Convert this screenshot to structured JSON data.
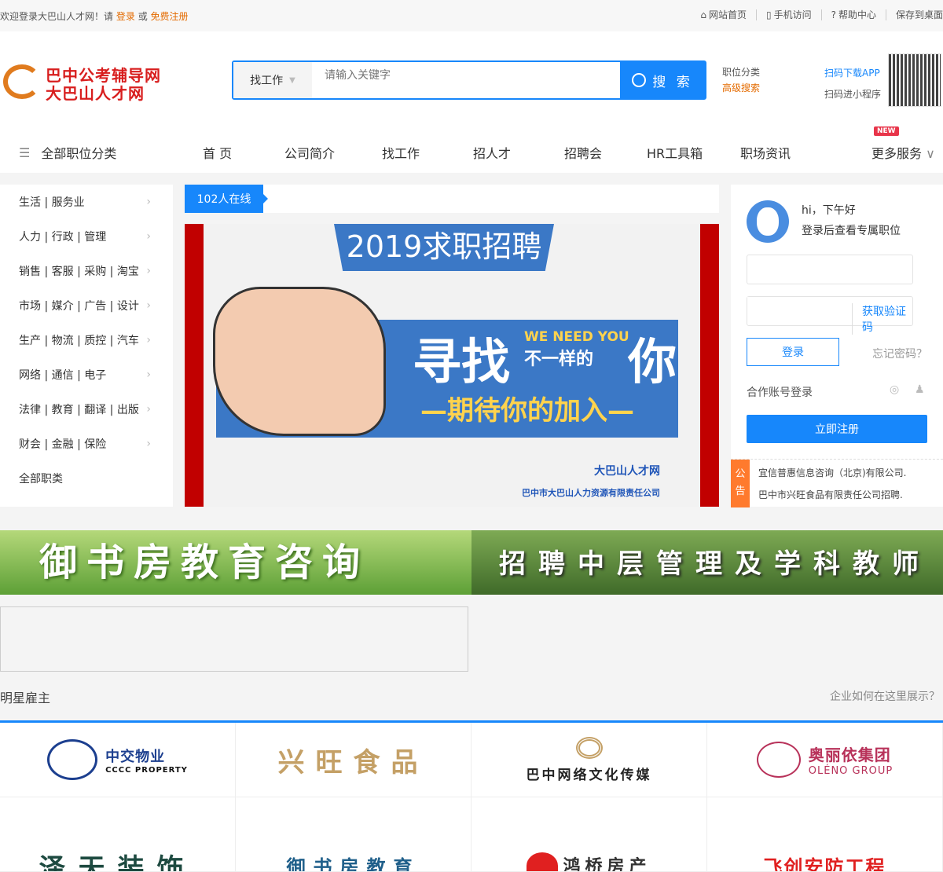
{
  "topbar": {
    "welcome": "欢迎登录大巴山人才网！请",
    "login": "登录",
    "or": "或",
    "register": "免费注册",
    "links": [
      {
        "icon": "home-icon",
        "label": "网站首页"
      },
      {
        "icon": "mobile-icon",
        "label": "手机访问"
      },
      {
        "icon": "help-icon",
        "label": "帮助中心"
      },
      {
        "icon": "",
        "label": "保存到桌面"
      }
    ]
  },
  "logo": {
    "line1": "巴中公考辅导网",
    "line2": "大巴山人才网"
  },
  "search": {
    "type": "找工作",
    "placeholder": "请输入关键字",
    "button": "搜 索"
  },
  "header_links": {
    "category": "职位分类",
    "advanced": "高级搜索",
    "app": "扫码下载APP",
    "mini": "扫码进小程序"
  },
  "nav": {
    "all": "全部职位分类",
    "items": [
      "首 页",
      "公司简介",
      "找工作",
      "招人才",
      "招聘会",
      "HR工具箱",
      "职场资讯",
      "更多服务"
    ],
    "new_badge": "NEW"
  },
  "sidebar": [
    "生活 | 服务业",
    "人力 | 行政 | 管理",
    "销售 | 客服 | 采购 | 淘宝",
    "市场 | 媒介 | 广告 | 设计",
    "生产 | 物流 | 质控 | 汽车",
    "网络 | 通信 | 电子",
    "法律 | 教育 | 翻译 | 出版",
    "财会 | 金融 | 保险",
    "全部职类"
  ],
  "online": "102人在线",
  "banner": {
    "title": "2019求职招聘",
    "big1": "寻找",
    "wny": "WE NEED YOU",
    "mid": "不一样的",
    "big2": "你",
    "sub": "—期待你的加入—",
    "brand": "大巴山人才网",
    "company": "巴中市大巴山人力资源有限责任公司"
  },
  "login": {
    "greeting": "hi，下午好",
    "tip": "登录后查看专属职位",
    "get_code": "获取验证码",
    "login_btn": "登录",
    "forgot": "忘记密码？",
    "partner": "合作账号登录",
    "register": "立即注册"
  },
  "notice": {
    "label1": "公",
    "label2": "告",
    "items": [
      "宜信普惠信息咨询（北京)有限公司.",
      "巴中市兴旺食品有限责任公司招聘."
    ]
  },
  "ads": [
    "御书房教育咨询",
    "招聘中层管理及学科教师"
  ],
  "employers": {
    "title": "明星雇主",
    "how": "企业如何在这里展示？",
    "logos": [
      {
        "name": "中交物业",
        "sub": "CCCC PROPERTY",
        "color": "#1c3f8f"
      },
      {
        "name": "兴旺食品",
        "color": "#c4a066"
      },
      {
        "name": "巴中网络文化传媒",
        "color": "#222222"
      },
      {
        "name": "奥丽依集团",
        "sub": "OLÉNO GROUP",
        "color": "#b8325a"
      },
      {
        "name": "泽天装饰",
        "color": "#1d4a40"
      },
      {
        "name": "御书房教育",
        "color": "#1f5f8a"
      },
      {
        "name": "鸿桥房产",
        "color": "#333333"
      },
      {
        "name": "飞创安防工程",
        "color": "#e02020"
      }
    ]
  },
  "colors": {
    "accent": "#1787fb",
    "orange": "#e46b00",
    "notice": "#ff7a2d"
  }
}
